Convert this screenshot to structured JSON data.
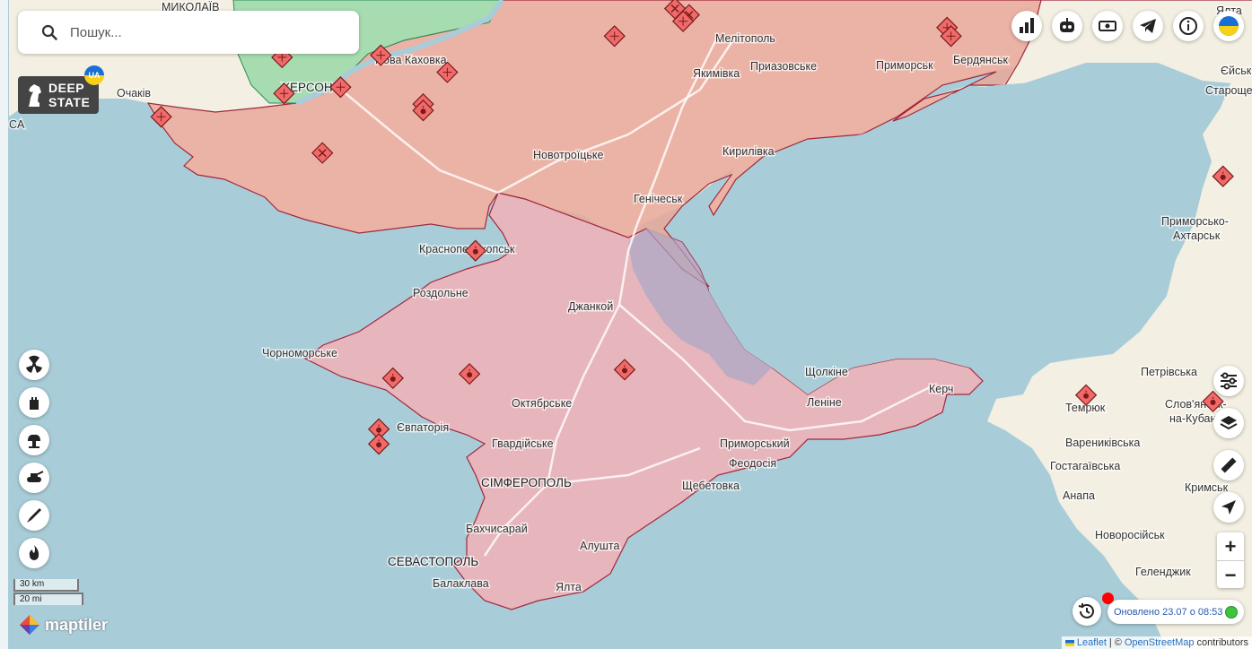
{
  "search": {
    "placeholder": "Пошук..."
  },
  "logo": {
    "line1": "DEEP",
    "line2": "STATE",
    "badge": "UA"
  },
  "top_buttons": [
    {
      "name": "stats-button",
      "icon": "bar-chart-icon"
    },
    {
      "name": "bot-button",
      "icon": "robot-icon"
    },
    {
      "name": "donate-button",
      "icon": "money-icon"
    },
    {
      "name": "telegram-button",
      "icon": "telegram-icon"
    },
    {
      "name": "info-button",
      "icon": "info-icon"
    },
    {
      "name": "language-button",
      "icon": "ukraine-flag-icon"
    }
  ],
  "left_buttons": [
    {
      "name": "nuclear-filter-button",
      "icon": "radiation-icon"
    },
    {
      "name": "fortification-filter-button",
      "icon": "castle-icon"
    },
    {
      "name": "explosion-filter-button",
      "icon": "explosion-icon"
    },
    {
      "name": "tank-filter-button",
      "icon": "tank-icon"
    },
    {
      "name": "missile-filter-button",
      "icon": "missile-icon"
    },
    {
      "name": "fire-filter-button",
      "icon": "fire-icon"
    }
  ],
  "right_buttons": [
    {
      "name": "settings-button",
      "icon": "sliders-icon"
    },
    {
      "name": "layers-button",
      "icon": "layers-icon"
    },
    {
      "name": "ruler-button",
      "icon": "ruler-icon"
    },
    {
      "name": "locate-button",
      "icon": "locate-arrow-icon"
    }
  ],
  "zoom": {
    "in": "+",
    "out": "−"
  },
  "scale": {
    "metric": "30 km",
    "imperial": "20 mi"
  },
  "maptiler_label": "maptiler",
  "status": {
    "text": "Оновлено 23.07 о 08:53"
  },
  "attribution": {
    "leaflet": "Leaflet",
    "sep": "|",
    "copy": "©",
    "osm": "OpenStreetMap",
    "contributors": "contributors"
  },
  "colors": {
    "sea": "#a9cdd8",
    "land": "#f3efe2",
    "occupied": "#e9a89a",
    "crimea": "#e7b5bc",
    "liberated": "#a6dcb0",
    "border": "#a0283e"
  },
  "labels": [
    {
      "text": "МИКОЛАЇВ"
    },
    {
      "text": "Нова Каховка"
    },
    {
      "text": "ХЕРСОН"
    },
    {
      "text": "Очаків"
    },
    {
      "text": "CA"
    },
    {
      "text": "Мелітополь"
    },
    {
      "text": "Якимівка"
    },
    {
      "text": "Приазовське"
    },
    {
      "text": "Приморськ"
    },
    {
      "text": "Бердянськ"
    },
    {
      "text": "Ялта"
    },
    {
      "text": "Єйськ"
    },
    {
      "text": "Староще"
    },
    {
      "text": "Новотроїцьке"
    },
    {
      "text": "Кирилівка"
    },
    {
      "text": "Генічеськ"
    },
    {
      "text": "Красноперекопськ"
    },
    {
      "text": "Роздольне"
    },
    {
      "text": "Джанкой"
    },
    {
      "text": "Чорноморське"
    },
    {
      "text": "Октябрське"
    },
    {
      "text": "Євпаторія"
    },
    {
      "text": "Гвардійське"
    },
    {
      "text": "СІМФЕРОПОЛЬ"
    },
    {
      "text": "Бахчисарай"
    },
    {
      "text": "СЕВАСТОПОЛЬ"
    },
    {
      "text": "Балаклава"
    },
    {
      "text": "Алушта"
    },
    {
      "text": "Ялта"
    },
    {
      "text": "Щебетовка"
    },
    {
      "text": "Феодосія"
    },
    {
      "text": "Приморський"
    },
    {
      "text": "Щолкіне"
    },
    {
      "text": "Леніне"
    },
    {
      "text": "Керч"
    },
    {
      "text": "Приморсько-"
    },
    {
      "text": "Ахтарськ"
    },
    {
      "text": "Петрівська"
    },
    {
      "text": "Темрюк"
    },
    {
      "text": "Слов'янськ-"
    },
    {
      "text": "на-Кубані"
    },
    {
      "text": "Варениківська"
    },
    {
      "text": "Гостагаївська"
    },
    {
      "text": "Анапа"
    },
    {
      "text": "Кримськ"
    },
    {
      "text": "Новоросійськ"
    },
    {
      "text": "Геленджик"
    }
  ],
  "markers": [
    {
      "kind": "strike",
      "lon": 35.35,
      "lat": 46.86
    },
    {
      "kind": "strike",
      "lon": 35.42,
      "lat": 46.83
    },
    {
      "kind": "hit",
      "lon": 35.39,
      "lat": 46.8
    },
    {
      "kind": "hit",
      "lon": 35.05,
      "lat": 46.73
    },
    {
      "kind": "hit",
      "lon": 36.7,
      "lat": 46.77
    },
    {
      "kind": "hit",
      "lon": 36.72,
      "lat": 46.73
    },
    {
      "kind": "hit",
      "lon": 33.4,
      "lat": 46.63
    },
    {
      "kind": "hit",
      "lon": 33.89,
      "lat": 46.64
    },
    {
      "kind": "hit",
      "lon": 34.22,
      "lat": 46.56
    },
    {
      "kind": "hit",
      "lon": 33.41,
      "lat": 46.46
    },
    {
      "kind": "hit",
      "lon": 33.69,
      "lat": 46.49
    },
    {
      "kind": "hit",
      "lon": 34.1,
      "lat": 46.41
    },
    {
      "kind": "bomb",
      "lon": 34.1,
      "lat": 46.38
    },
    {
      "kind": "hit",
      "lon": 32.8,
      "lat": 46.35
    },
    {
      "kind": "strike",
      "lon": 33.6,
      "lat": 46.18
    },
    {
      "kind": "bomb",
      "lon": 34.36,
      "lat": 45.72
    },
    {
      "kind": "bomb",
      "lon": 33.95,
      "lat": 45.12
    },
    {
      "kind": "bomb",
      "lon": 34.33,
      "lat": 45.14
    },
    {
      "kind": "bomb",
      "lon": 35.1,
      "lat": 45.16
    },
    {
      "kind": "bomb",
      "lon": 33.88,
      "lat": 44.88
    },
    {
      "kind": "bomb",
      "lon": 33.88,
      "lat": 44.81
    },
    {
      "kind": "bomb",
      "lon": 38.27,
      "lat": 46.7
    },
    {
      "kind": "bomb",
      "lon": 38.07,
      "lat": 46.07
    },
    {
      "kind": "bomb",
      "lon": 37.39,
      "lat": 45.04
    },
    {
      "kind": "bomb",
      "lon": 38.02,
      "lat": 45.01
    }
  ]
}
